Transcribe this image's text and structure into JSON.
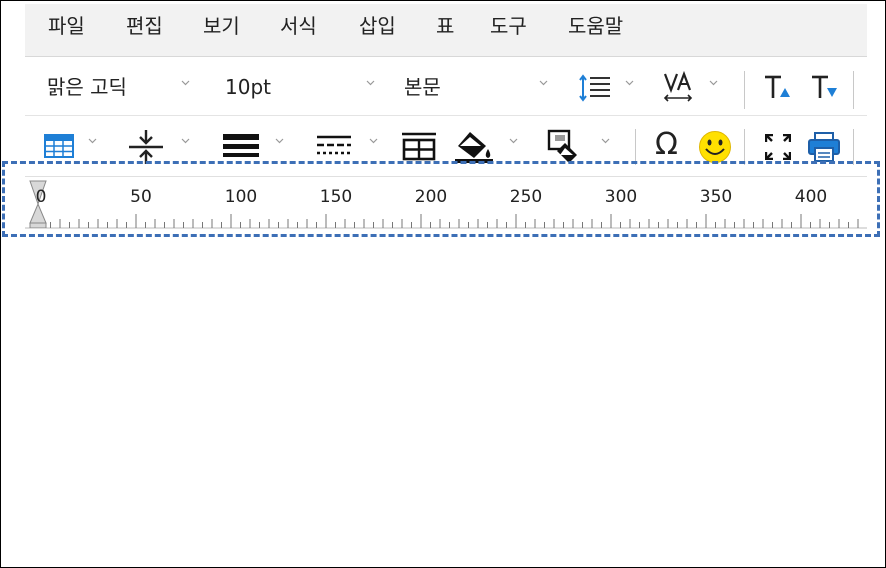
{
  "menu": {
    "items": [
      "파일",
      "편집",
      "보기",
      "서식",
      "삽입",
      "표",
      "도구",
      "도움말"
    ]
  },
  "toolbar1": {
    "font_name": "맑은 고딕",
    "font_size": "10pt",
    "paragraph_style": "본문",
    "icons": [
      "line-spacing-icon",
      "character-spacing-icon",
      "font-size-up-icon",
      "font-size-down-icon"
    ]
  },
  "toolbar2": {
    "icons": [
      "table-icon",
      "cell-spacing-icon",
      "border-thickness-icon",
      "border-style-icon",
      "cell-split-icon",
      "fill-color-icon",
      "cell-format-icon",
      "special-character-icon",
      "emoticon-icon",
      "fullscreen-icon",
      "print-icon"
    ],
    "omega": "Ω"
  },
  "ruler": {
    "labels": [
      "0",
      "50",
      "100",
      "150",
      "200",
      "250",
      "300",
      "350",
      "400"
    ]
  },
  "colors": {
    "highlight": "#3d6fb6",
    "accent_blue": "#1e7fd6",
    "emoji_yellow": "#ffe000",
    "menubar_bg": "#f2f2f2"
  }
}
